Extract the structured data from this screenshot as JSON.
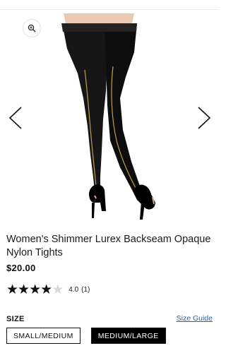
{
  "product": {
    "title": "Women's Shimmer Lurex Backseam Opaque Nylon Tights",
    "price": "$20.00",
    "image_icon": "tights-product-photo"
  },
  "gallery": {
    "zoom_icon": "zoom-in-icon",
    "prev_icon": "chevron-left-icon",
    "next_icon": "chevron-right-icon"
  },
  "rating": {
    "stars_filled": 4,
    "stars_total": 5,
    "value": "4.0",
    "count": "(1)"
  },
  "size": {
    "label": "SIZE",
    "guide_label": "Size Guide",
    "options": [
      "SMALL/MEDIUM",
      "MEDIUM/LARGE"
    ],
    "selected": "MEDIUM/LARGE"
  },
  "colors": {
    "accent_link": "#2a5db0",
    "selected_bg": "#000000"
  }
}
